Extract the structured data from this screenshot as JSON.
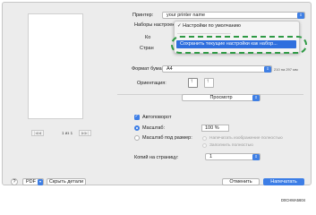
{
  "printer": {
    "label": "Принтер:",
    "value": "your printer name"
  },
  "presets": {
    "label": "Наборы настроек",
    "value": "Настройки по умолчанию"
  },
  "copies_label_partial": "Ко",
  "pages_label_partial": "Стран",
  "presets_menu": {
    "checked_item": "Настройки по умолчанию",
    "highlighted_item": "Сохранить текущие настройки как набор..."
  },
  "paper": {
    "label": "Формат бумаги:",
    "value": "A4",
    "size_text": "210 на 297 мм"
  },
  "orientation": {
    "label": "Ориентация:"
  },
  "section_select": {
    "value": "Просмотр"
  },
  "preview": {
    "page_indicator": "1 из 1"
  },
  "autorotate": {
    "label": "Автоповорот",
    "checked": true
  },
  "scale": {
    "label": "Масштаб:",
    "value": "100 %"
  },
  "fit": {
    "label": "Масштаб под размер:",
    "option1": "Напечатать изображение полностью",
    "option2": "Заполнить полностью"
  },
  "copies_per_page": {
    "label": "Копий на страницу:",
    "value": "1"
  },
  "bottom": {
    "help": "?",
    "pdf": "PDF",
    "hide_details": "Скрыть детали",
    "cancel": "Отменить",
    "print": "Напечатать"
  },
  "image_code": "D0CHMA5604",
  "colors": {
    "accent": "#3d7ee6",
    "callout": "#2e9a44",
    "dialog_bg": "#ececec"
  }
}
